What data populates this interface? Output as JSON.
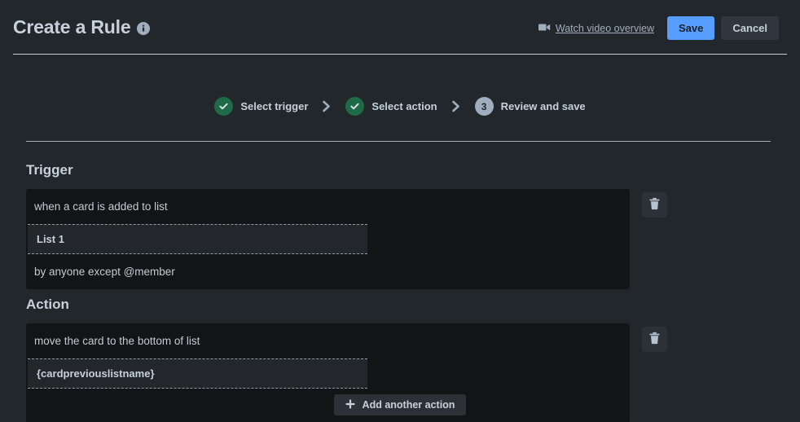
{
  "header": {
    "title": "Create a Rule",
    "info_icon": "info-icon",
    "watch_video_label": "Watch video overview",
    "video_icon": "video-camera-icon",
    "save_label": "Save",
    "cancel_label": "Cancel",
    "save_color": "#579dff"
  },
  "stepper": {
    "steps": [
      {
        "marker": "check",
        "label": "Select trigger",
        "state": "done"
      },
      {
        "marker": "check",
        "label": "Select action",
        "state": "done"
      },
      {
        "marker": "3",
        "label": "Review and save",
        "state": "current"
      }
    ],
    "separator_icon": "chevron-right-icon",
    "done_color": "#1f6b47",
    "current_color": "#9fadbc"
  },
  "trigger": {
    "heading": "Trigger",
    "line1": "when a card is added to list",
    "field_value": "List 1",
    "line2": "by anyone except @member",
    "delete_icon": "trash-icon"
  },
  "action": {
    "heading": "Action",
    "line1": "move the card to the bottom of list",
    "field_value": "{cardpreviouslistname}",
    "delete_icon": "trash-icon"
  },
  "footer": {
    "add_action_label": "Add another action",
    "add_icon": "plus-icon"
  }
}
